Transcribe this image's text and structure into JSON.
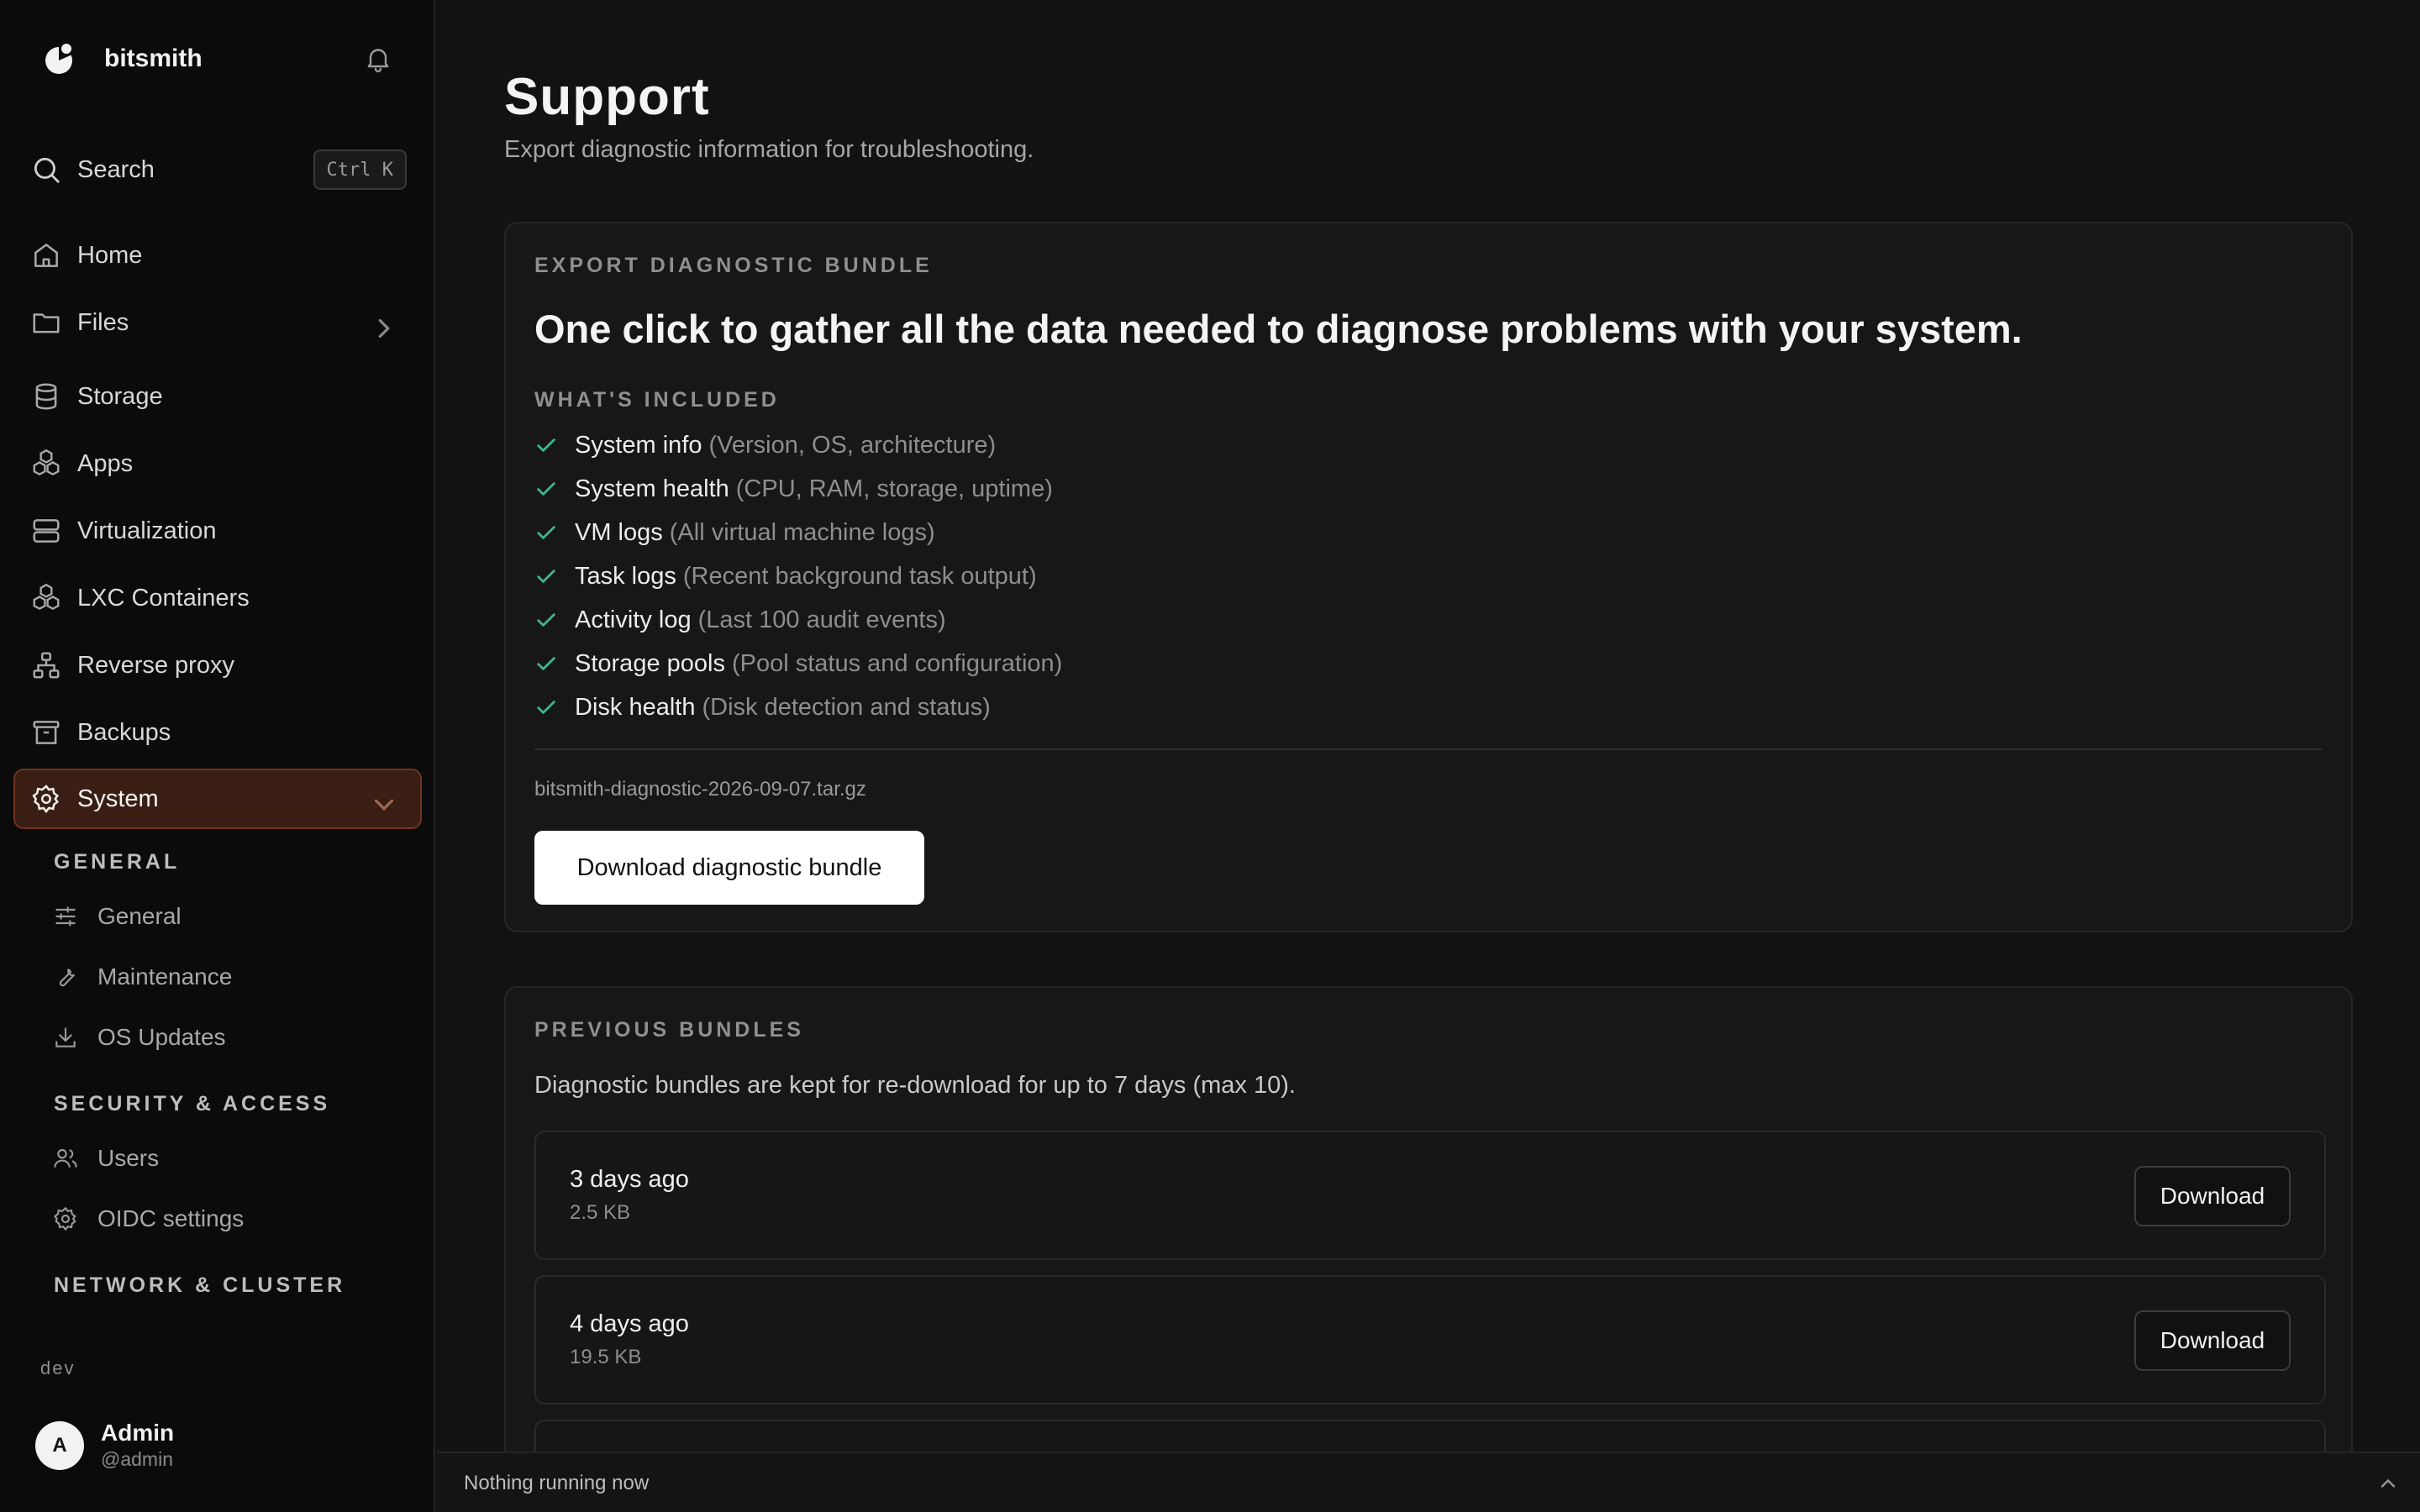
{
  "app": {
    "name": "bitsmith"
  },
  "search": {
    "label": "Search",
    "shortcut": "Ctrl K"
  },
  "sidebar": {
    "nav": [
      {
        "label": "Home",
        "icon": "home-icon"
      },
      {
        "label": "Files",
        "icon": "folder-icon"
      },
      {
        "label": "Storage",
        "icon": "database-icon"
      },
      {
        "label": "Apps",
        "icon": "apps-icon"
      },
      {
        "label": "Virtualization",
        "icon": "server-icon"
      },
      {
        "label": "LXC Containers",
        "icon": "containers-icon"
      },
      {
        "label": "Reverse proxy",
        "icon": "network-icon"
      },
      {
        "label": "Backups",
        "icon": "archive-icon"
      },
      {
        "label": "System",
        "icon": "gear-icon",
        "active": true
      }
    ],
    "sections": [
      {
        "title": "GENERAL",
        "items": [
          {
            "label": "General",
            "icon": "sliders-icon"
          },
          {
            "label": "Maintenance",
            "icon": "wrench-icon"
          },
          {
            "label": "OS Updates",
            "icon": "download-icon"
          }
        ]
      },
      {
        "title": "SECURITY & ACCESS",
        "items": [
          {
            "label": "Users",
            "icon": "users-icon"
          },
          {
            "label": "OIDC settings",
            "icon": "gear-icon"
          }
        ]
      },
      {
        "title": "NETWORK & CLUSTER",
        "items": []
      }
    ],
    "env": "dev",
    "user": {
      "initial": "A",
      "name": "Admin",
      "handle": "@admin"
    }
  },
  "page": {
    "title": "Support",
    "subtitle": "Export diagnostic information for troubleshooting."
  },
  "export_card": {
    "eyebrow": "EXPORT DIAGNOSTIC BUNDLE",
    "headline": "One click to gather all the data needed to diagnose problems with your system.",
    "included_title": "WHAT'S INCLUDED",
    "included": [
      {
        "name": "System info",
        "desc": "(Version, OS, architecture)"
      },
      {
        "name": "System health",
        "desc": "(CPU, RAM, storage, uptime)"
      },
      {
        "name": "VM logs",
        "desc": "(All virtual machine logs)"
      },
      {
        "name": "Task logs",
        "desc": "(Recent background task output)"
      },
      {
        "name": "Activity log",
        "desc": "(Last 100 audit events)"
      },
      {
        "name": "Storage pools",
        "desc": "(Pool status and configuration)"
      },
      {
        "name": "Disk health",
        "desc": "(Disk detection and status)"
      }
    ],
    "filename": "bitsmith-diagnostic-2026-09-07.tar.gz",
    "button_label": "Download diagnostic bundle"
  },
  "previous_card": {
    "eyebrow": "PREVIOUS BUNDLES",
    "description": "Diagnostic bundles are kept for re-download for up to 7 days (max 10).",
    "bundles": [
      {
        "when": "3 days ago",
        "size": "2.5 KB",
        "button_label": "Download"
      },
      {
        "when": "4 days ago",
        "size": "19.5 KB",
        "button_label": "Download"
      }
    ]
  },
  "status": {
    "text": "Nothing running now"
  },
  "colors": {
    "accent_bg": "#3a1e14",
    "accent_border": "#6e3421",
    "check": "#3fb58a"
  }
}
